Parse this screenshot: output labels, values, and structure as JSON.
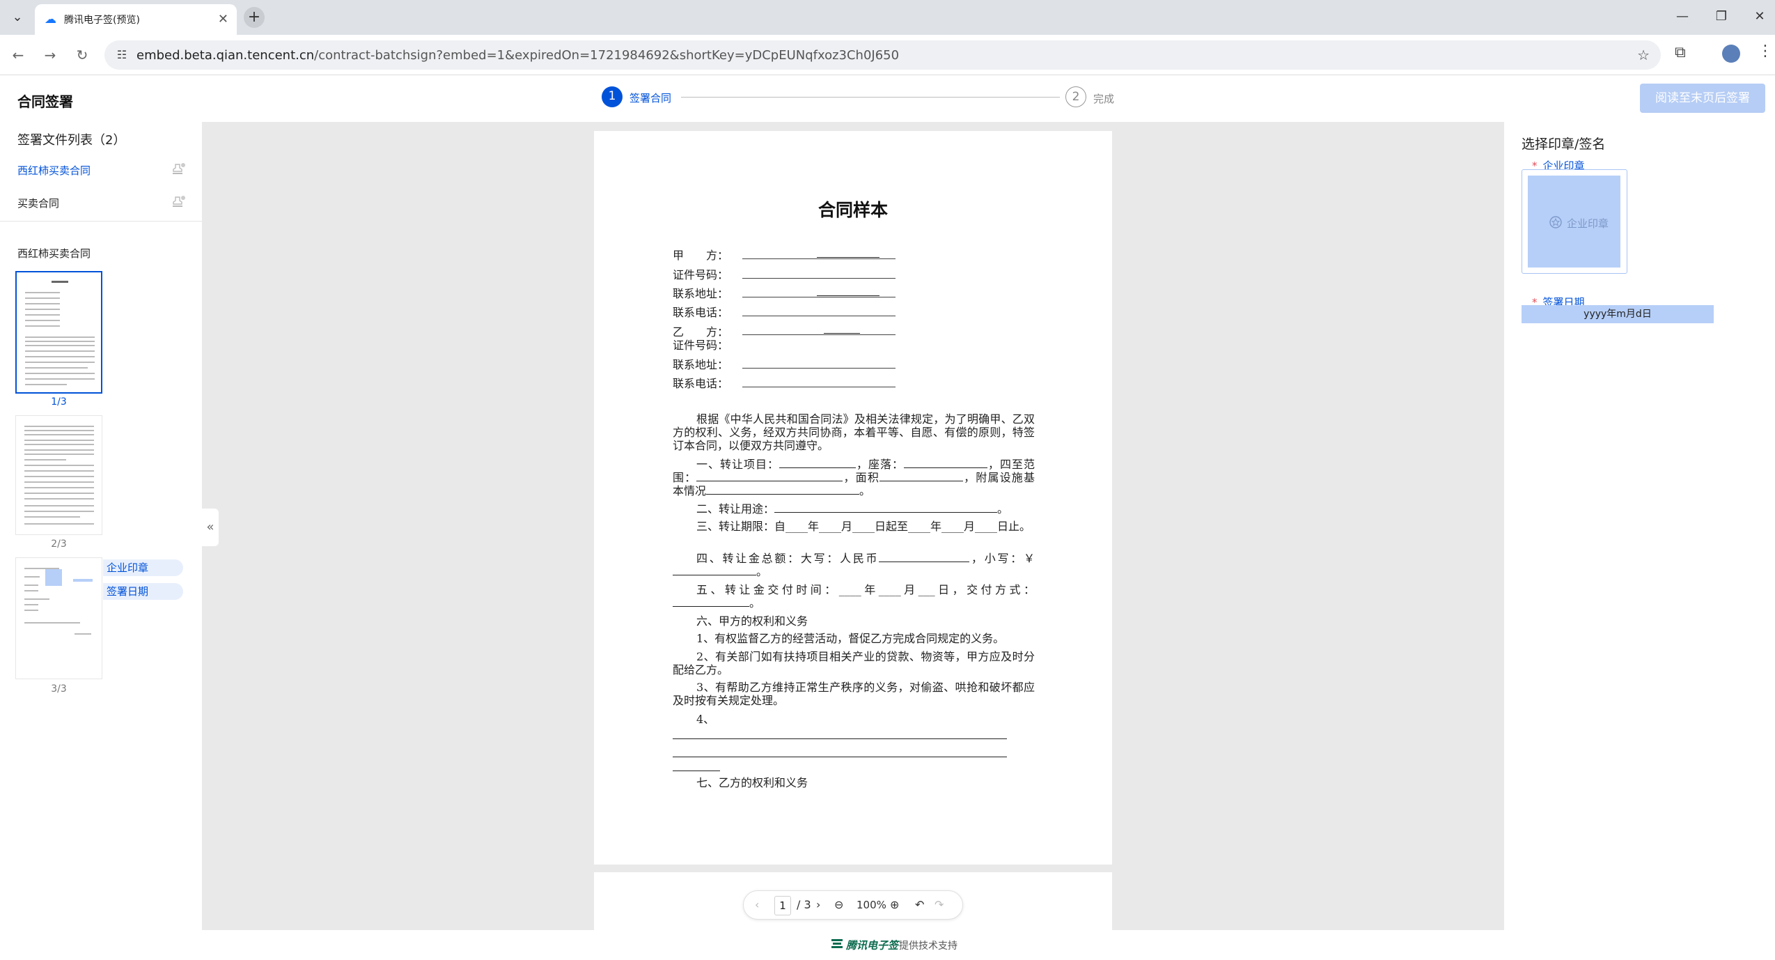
{
  "browser": {
    "tab_title": "腾讯电子签(预览)",
    "url_host": "embed.beta.qian.tencent.cn",
    "url_path": "/contract-batchsign?embed=1&expiredOn=1721984692&shortKey=yDCpEUNqfxoz3Ch0J650"
  },
  "header": {
    "title": "合同签署",
    "steps": [
      {
        "number": "1",
        "label": "签署合同"
      },
      {
        "number": "2",
        "label": "完成"
      }
    ],
    "sign_button": "阅读至末页后签署"
  },
  "sidebar": {
    "file_list_title": "签署文件列表（2）",
    "files": [
      {
        "name": "西红柿买卖合同"
      },
      {
        "name": "买卖合同"
      }
    ],
    "current_doc_title": "西红柿买卖合同",
    "pages": [
      "1/3",
      "2/3",
      "3/3"
    ],
    "page3_fields": [
      "企业印章",
      "签署日期"
    ]
  },
  "document": {
    "title": "合同样本",
    "party_rows": [
      "甲　　方：",
      "证件号码：",
      "联系地址：",
      "联系电话：",
      "乙　　方：",
      "证件号码：",
      "联系地址：",
      "联系电话："
    ],
    "p1": "根据《中华人民共和国合同法》及相关法律规定，为了明确甲、乙双方的权利、义务，经双方共同协商，本着平等、自愿、有偿的原则，特签订本合同，以便双方共同遵守。",
    "p2a": "一、转让项目：",
    "p2b": "，座落：",
    "p2c": "，四至范围：",
    "p2d": "，面积",
    "p2e": "，附属设施基本情况",
    "p3": "二、转让用途：",
    "p4": "三、转让期限：自____年____月____日起至____年____月____日止。",
    "p5a": "四、转让金总额：大写：人民币",
    "p5b": "，小写：￥",
    "p6": "五、转让金交付时间：____年____月___日，交付方式：",
    "p7": "六、甲方的权利和义务",
    "p8": "1、有权监督乙方的经营活动，督促乙方完成合同规定的义务。",
    "p9": "2、有关部门如有扶持项目相关产业的贷款、物资等，甲方应及时分配给乙方。",
    "p10": "3、有帮助乙方维持正常生产秩序的义务，对偷盗、哄抢和破坏都应及时按有关规定处理。",
    "p11": "4、",
    "p12": "七、乙方的权利和义务",
    "period": "。"
  },
  "page_controls": {
    "current_page": "1",
    "total": "/ 3",
    "zoom": "100%"
  },
  "right_panel": {
    "title": "选择印章/签名",
    "seal_field_label": "企业印章",
    "seal_placeholder": "企业印章",
    "date_field_label": "签署日期",
    "date_placeholder": "yyyy年m月d日"
  },
  "footer": {
    "brand": "腾讯电子签",
    "support": "提供技术支持"
  },
  "colors": {
    "primary": "#0052d9",
    "disabled_button": "#b6cdf5",
    "seal_fill": "#b6cff8",
    "required": "#e34d59"
  }
}
